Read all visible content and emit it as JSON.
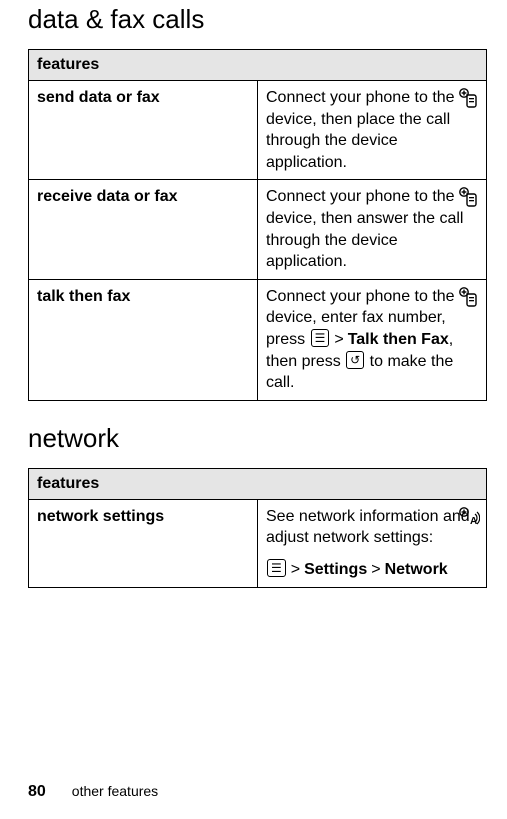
{
  "sections": {
    "dataFax": {
      "title": "data & fax calls",
      "header": "features",
      "rows": {
        "send": {
          "name": "send data or fax",
          "desc": "Connect your phone to the device, then place the call through the device application."
        },
        "receive": {
          "name": "receive data or fax",
          "desc": "Connect your phone to the device, then answer the call through the device application."
        },
        "talkThenFax": {
          "name": "talk then fax",
          "desc_pre": "Connect your phone to the device, enter fax number, press ",
          "menu_label": "Talk then Fax",
          "desc_mid": ", then press ",
          "desc_post": " to make the call."
        }
      }
    },
    "network": {
      "title": "network",
      "header": "features",
      "rows": {
        "settings": {
          "name": "network settings",
          "desc": "See network information and adjust network settings:",
          "path1": "Settings",
          "path2": "Network"
        }
      }
    }
  },
  "glyphs": {
    "menu_key": "☰",
    "call_key": "↺",
    "gt": ">"
  },
  "footer": {
    "page": "80",
    "label": "other features"
  }
}
